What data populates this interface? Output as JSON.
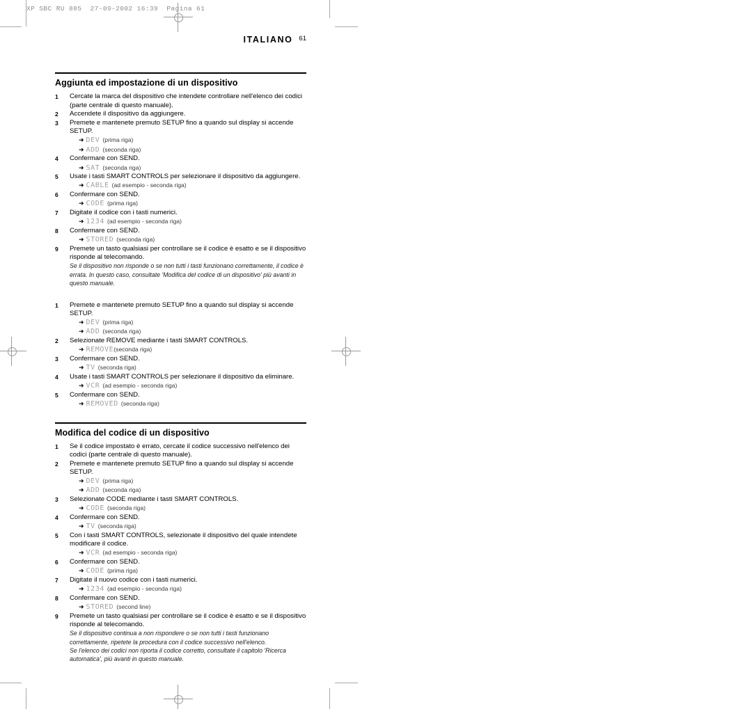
{
  "scan_header": "XP SBC RU 885  27-09-2002 16:39  Pagina 61",
  "running_head": {
    "language": "ITALIANO",
    "page_number": "61"
  },
  "icons": {
    "arrow": "➜"
  },
  "colors": {
    "lcd_text": "#a0a0a0",
    "rule": "#000000",
    "crop_mark": "#9a9a9a"
  },
  "sections": [
    {
      "title": "Aggiunta ed impostazione di un dispositivo",
      "steps": [
        {
          "num": "1",
          "text": "Cercate la marca del dispositivo che intendete controllare nell'elenco dei codici (parte centrale di questo manuale)."
        },
        {
          "num": "2",
          "text": "Accendete il dispositivo da aggiungere."
        },
        {
          "num": "3",
          "text": "Premete e mantenete premuto SETUP fino a quando sul display si accende SETUP.",
          "displays": [
            {
              "lcd": "DEV",
              "note": "(prima riga)"
            },
            {
              "lcd": "ADD",
              "note": "(seconda riga)"
            }
          ]
        },
        {
          "num": "4",
          "text": "Confermare con SEND.",
          "displays": [
            {
              "lcd": "SAT",
              "note": "(seconda riga)"
            }
          ]
        },
        {
          "num": "5",
          "text": "Usate i tasti SMART CONTROLS per selezionare il dispositivo da aggiungere.",
          "displays": [
            {
              "lcd": "CABLE",
              "note": "(ad esempio - seconda riga)"
            }
          ]
        },
        {
          "num": "6",
          "text": "Confermare con SEND.",
          "displays": [
            {
              "lcd": "CODE",
              "note": "(prima riga)"
            }
          ]
        },
        {
          "num": "7",
          "text": "Digitate il codice con i tasti numerici.",
          "displays": [
            {
              "lcd": "1234",
              "note": "(ad esempio - seconda riga)"
            }
          ]
        },
        {
          "num": "8",
          "text": "Confermare con SEND.",
          "displays": [
            {
              "lcd": "STORED",
              "note": "(seconda riga)"
            }
          ]
        },
        {
          "num": "9",
          "text": "Premete un tasto qualsiasi per controllare se il codice è esatto e se il dispositivo risponde al telecomando.",
          "remarks": [
            "Se il dispositivo non risponde o se non tutti i tasti funzionano correttamente, il codice è errata. In questo caso, consultate 'Modifica del codice di un dispositivo' più avanti in questo manuale."
          ]
        }
      ]
    },
    {
      "title": "",
      "steps": [
        {
          "num": "1",
          "text": "Premete e mantenete premuto SETUP fino a quando sul display si accende SETUP.",
          "displays": [
            {
              "lcd": "DEV",
              "note": "(prima riga)"
            },
            {
              "lcd": "ADD",
              "note": "(seconda riga)"
            }
          ]
        },
        {
          "num": "2",
          "text": "Selezionate REMOVE mediante i tasti SMART CONTROLS.",
          "displays": [
            {
              "lcd": "REMOVE",
              "note": "(seconda riga)",
              "tight": true
            }
          ]
        },
        {
          "num": "3",
          "text": "Confermare con SEND.",
          "displays": [
            {
              "lcd": "TV",
              "note": "(seconda riga)"
            }
          ]
        },
        {
          "num": "4",
          "text": "Usate i tasti SMART CONTROLS per selezionare il dispositivo da eliminare.",
          "displays": [
            {
              "lcd": "VCR",
              "note": "(ad esempio - seconda riga)"
            }
          ]
        },
        {
          "num": "5",
          "text": "Confermare con SEND.",
          "displays": [
            {
              "lcd": "REMOVED",
              "note": "(seconda riga)"
            }
          ]
        }
      ]
    },
    {
      "title": "Modifica del codice di un dispositivo",
      "steps": [
        {
          "num": "1",
          "text": "Se il codice impostato è errato, cercate il codice successivo nell'elenco dei codici (parte centrale di questo manuale)."
        },
        {
          "num": "2",
          "text": "Premete e mantenete premuto SETUP fino a quando sul display si accende SETUP.",
          "displays": [
            {
              "lcd": "DEV",
              "note": "(prima riga)"
            },
            {
              "lcd": "ADD",
              "note": "(seconda riga)"
            }
          ]
        },
        {
          "num": "3",
          "text": "Selezionate CODE mediante i tasti SMART CONTROLS.",
          "displays": [
            {
              "lcd": "CODE",
              "note": "(seconda riga)"
            }
          ]
        },
        {
          "num": "4",
          "text": "Confermare con SEND.",
          "displays": [
            {
              "lcd": "TV",
              "note": "(seconda riga)"
            }
          ]
        },
        {
          "num": "5",
          "text": "Con i tasti SMART CONTROLS, selezionate il dispositivo del quale intendete modificare il codice.",
          "displays": [
            {
              "lcd": "VCR",
              "note": "(ad esempio - seconda riga)"
            }
          ]
        },
        {
          "num": "6",
          "text": "Confermare con SEND.",
          "displays": [
            {
              "lcd": "CODE",
              "note": "(prima riga)"
            }
          ]
        },
        {
          "num": "7",
          "text": "Digitate il nuovo codice con i tasti numerici.",
          "displays": [
            {
              "lcd": "1234",
              "note": "(ad esempio - seconda riga)"
            }
          ]
        },
        {
          "num": "8",
          "text": "Confermare con SEND.",
          "displays": [
            {
              "lcd": "STORED",
              "note": "(second line)"
            }
          ]
        },
        {
          "num": "9",
          "text": "Premete un tasto qualsiasi per controllare se il codice è esatto e se il dispositivo risponde al telecomando.",
          "remarks": [
            "Se il dispositivo continua a non rispondere o se non tutti i tasti funzionano correttamente, ripetete la procedura con il codice successivo nell'elenco.",
            "Se l'elenco dei codici non riporta il codice corretto, consultate il capitolo 'Ricerca automatica', più avanti in questo manuale."
          ]
        }
      ]
    }
  ]
}
